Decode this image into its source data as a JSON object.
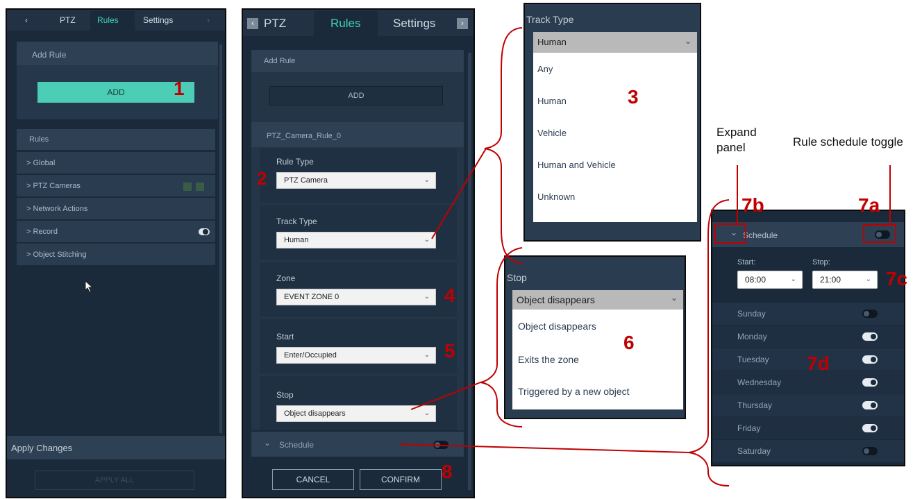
{
  "panel1": {
    "tabs": [
      "PTZ",
      "Rules",
      "Settings"
    ],
    "add_rule_header": "Add Rule",
    "add_button": "ADD",
    "rules_header": "Rules",
    "rule_items": [
      "> Global",
      "> PTZ Cameras",
      "> Network Actions",
      "> Record",
      "> Object Stitching"
    ],
    "apply_changes_header": "Apply Changes",
    "apply_all_button": "APPLY ALL"
  },
  "panel2": {
    "tabs": [
      "PTZ",
      "Rules",
      "Settings"
    ],
    "add_rule_header": "Add Rule",
    "add_button": "ADD",
    "rule_name": "PTZ_Camera_Rule_0",
    "rule_type_label": "Rule Type",
    "rule_type_value": "PTZ Camera",
    "track_type_label": "Track Type",
    "track_type_value": "Human",
    "zone_label": "Zone",
    "zone_value": "EVENT ZONE 0",
    "start_label": "Start",
    "start_value": "Enter/Occupied",
    "stop_label": "Stop",
    "stop_value": "Object disappears",
    "schedule_label": "Schedule",
    "cancel_button": "CANCEL",
    "confirm_button": "CONFIRM"
  },
  "track_popup": {
    "title": "Track Type",
    "selected": "Human",
    "options": [
      "Any",
      "Human",
      "Vehicle",
      "Human and Vehicle",
      "Unknown"
    ]
  },
  "stop_popup": {
    "title": "Stop",
    "selected": "Object disappears",
    "options": [
      "Object disappears",
      "Exits the zone",
      "Triggered by a new object"
    ]
  },
  "schedule_panel": {
    "header": "Schedule",
    "start_label": "Start:",
    "stop_label": "Stop:",
    "start_value": "08:00",
    "stop_value": "21:00",
    "days": [
      {
        "name": "Sunday",
        "on": false
      },
      {
        "name": "Monday",
        "on": true
      },
      {
        "name": "Tuesday",
        "on": true
      },
      {
        "name": "Wednesday",
        "on": true
      },
      {
        "name": "Thursday",
        "on": true
      },
      {
        "name": "Friday",
        "on": true
      },
      {
        "name": "Saturday",
        "on": false
      }
    ]
  },
  "callouts": {
    "n1": "1",
    "n2": "2",
    "n3": "3",
    "n4": "4",
    "n5": "5",
    "n6": "6",
    "n7a": "7a",
    "n7b": "7b",
    "n7c": "7c",
    "n7d": "7d",
    "n8": "8"
  },
  "annotations": {
    "expand_panel": "Expand panel",
    "rule_schedule_toggle": "Rule schedule toggle"
  },
  "colors": {
    "panel_bg": "#1b2a3a",
    "accent_teal": "#3fd0b9",
    "callout_red": "#c00000"
  }
}
